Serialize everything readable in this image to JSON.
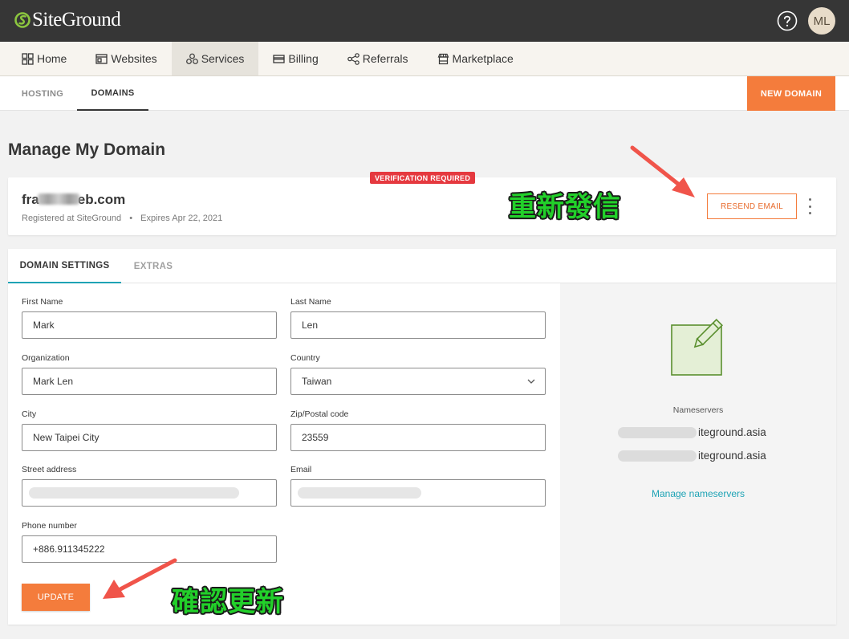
{
  "brand": {
    "name": "SiteGround"
  },
  "topbar": {
    "avatar_initials": "ML",
    "help_icon": "question-circle-icon"
  },
  "nav": [
    {
      "label": "Home",
      "icon": "grid-icon"
    },
    {
      "label": "Websites",
      "icon": "browser-icon"
    },
    {
      "label": "Services",
      "icon": "services-icon",
      "active": true
    },
    {
      "label": "Billing",
      "icon": "credit-card-icon"
    },
    {
      "label": "Referrals",
      "icon": "share-icon"
    },
    {
      "label": "Marketplace",
      "icon": "store-icon"
    }
  ],
  "subnav": {
    "tabs": [
      {
        "label": "HOSTING"
      },
      {
        "label": "DOMAINS",
        "active": true
      }
    ],
    "new_domain_label": "NEW DOMAIN"
  },
  "page": {
    "title": "Manage My Domain"
  },
  "domain_card": {
    "badge": "VERIFICATION REQUIRED",
    "name_prefix": "fra",
    "name_suffix": "eb.com",
    "registered": "Registered at SiteGround",
    "separator": "•",
    "expires": "Expires Apr 22, 2021",
    "resend_label": "RESEND EMAIL"
  },
  "settings": {
    "tabs": [
      {
        "label": "DOMAIN SETTINGS",
        "active": true
      },
      {
        "label": "EXTRAS"
      }
    ],
    "fields": {
      "first_name": {
        "label": "First Name",
        "value": "Mark"
      },
      "last_name": {
        "label": "Last Name",
        "value": "Len"
      },
      "organization": {
        "label": "Organization",
        "value": "Mark Len"
      },
      "country": {
        "label": "Country",
        "value": "Taiwan"
      },
      "city": {
        "label": "City",
        "value": "New Taipei City"
      },
      "zip": {
        "label": "Zip/Postal code",
        "value": "23559"
      },
      "street": {
        "label": "Street address",
        "value": ""
      },
      "email": {
        "label": "Email",
        "value": ""
      },
      "phone": {
        "label": "Phone number",
        "value": "+886.911345222"
      }
    },
    "update_label": "UPDATE",
    "nameservers": {
      "label": "Nameservers",
      "ns1_suffix": "iteground.asia",
      "ns2_suffix": "iteground.asia",
      "manage_label": "Manage nameservers"
    }
  },
  "annotations": {
    "resend": "重新發信",
    "update": "確認更新"
  },
  "colors": {
    "accent": "#f47c3c",
    "teal": "#1fa3b5",
    "topbar": "#363636",
    "badge": "#e5393f",
    "annotation": "#22d02a",
    "arrow": "#f0544a"
  }
}
